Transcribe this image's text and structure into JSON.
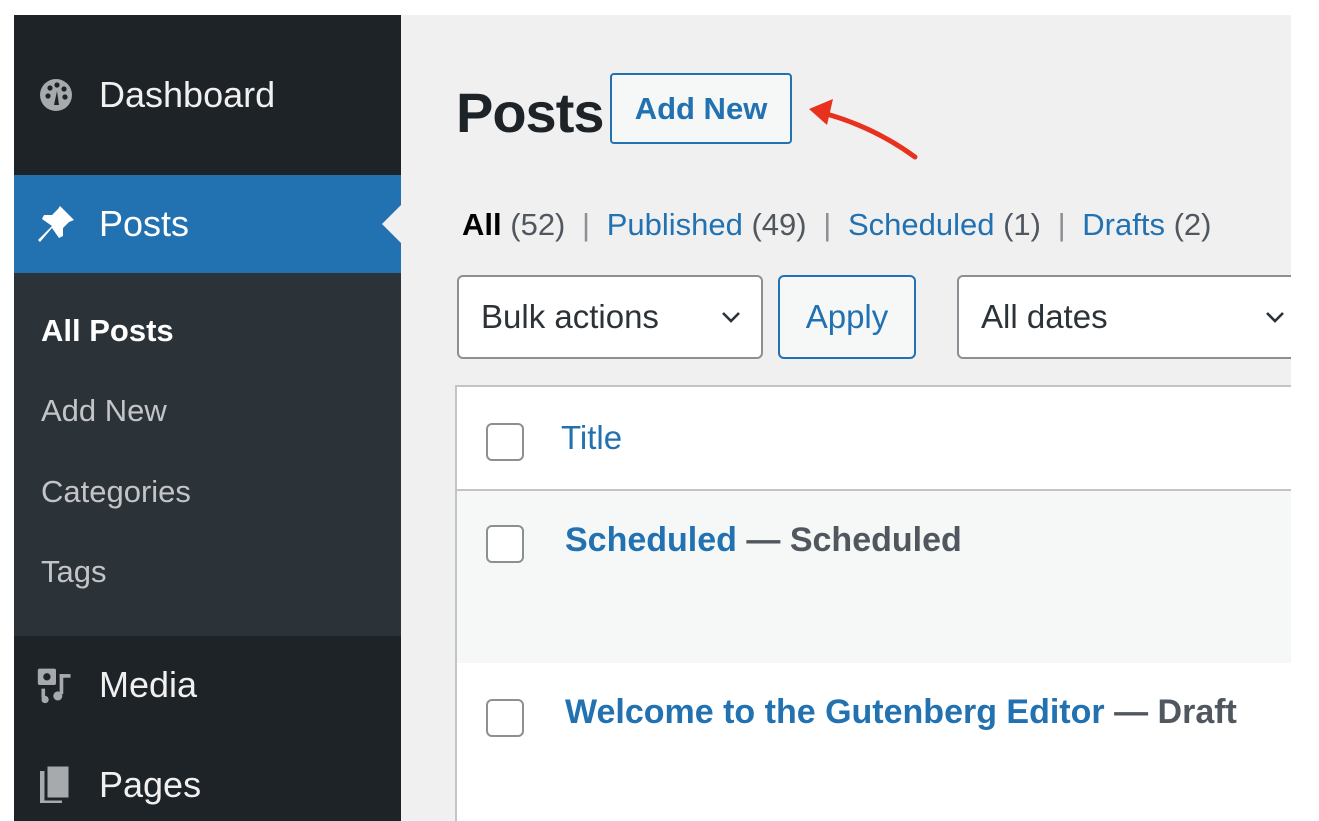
{
  "sidebar": {
    "dashboard": {
      "label": "Dashboard",
      "icon": "dashboard-gauge-icon"
    },
    "posts": {
      "label": "Posts",
      "icon": "pushpin-icon"
    },
    "submenu": [
      {
        "label": "All Posts",
        "current": true
      },
      {
        "label": "Add New",
        "current": false
      },
      {
        "label": "Categories",
        "current": false
      },
      {
        "label": "Tags",
        "current": false
      }
    ],
    "media": {
      "label": "Media",
      "icon": "media-icon"
    },
    "pages": {
      "label": "Pages",
      "icon": "pages-icon"
    }
  },
  "main": {
    "title": "Posts",
    "add_new_label": "Add New",
    "annotation_arrow_color": "#e8321e",
    "filters": {
      "all": {
        "label": "All",
        "count": "(52)"
      },
      "published": {
        "label": "Published",
        "count": "(49)"
      },
      "scheduled": {
        "label": "Scheduled",
        "count": "(1)"
      },
      "drafts": {
        "label": "Drafts",
        "count": "(2)"
      },
      "separator": "|"
    },
    "bulk_actions": {
      "selected": "Bulk actions"
    },
    "apply_label": "Apply",
    "date_filter": {
      "selected": "All dates"
    },
    "table": {
      "column_title": "Title",
      "rows": [
        {
          "title": "Scheduled",
          "state": "— Scheduled"
        },
        {
          "title": "Welcome to the Gutenberg Editor",
          "state": "— Draft"
        }
      ]
    }
  },
  "colors": {
    "sidebar_bg": "#1d2327",
    "submenu_bg": "#2c3338",
    "accent": "#2271b1",
    "content_bg": "#f0f0f1"
  }
}
